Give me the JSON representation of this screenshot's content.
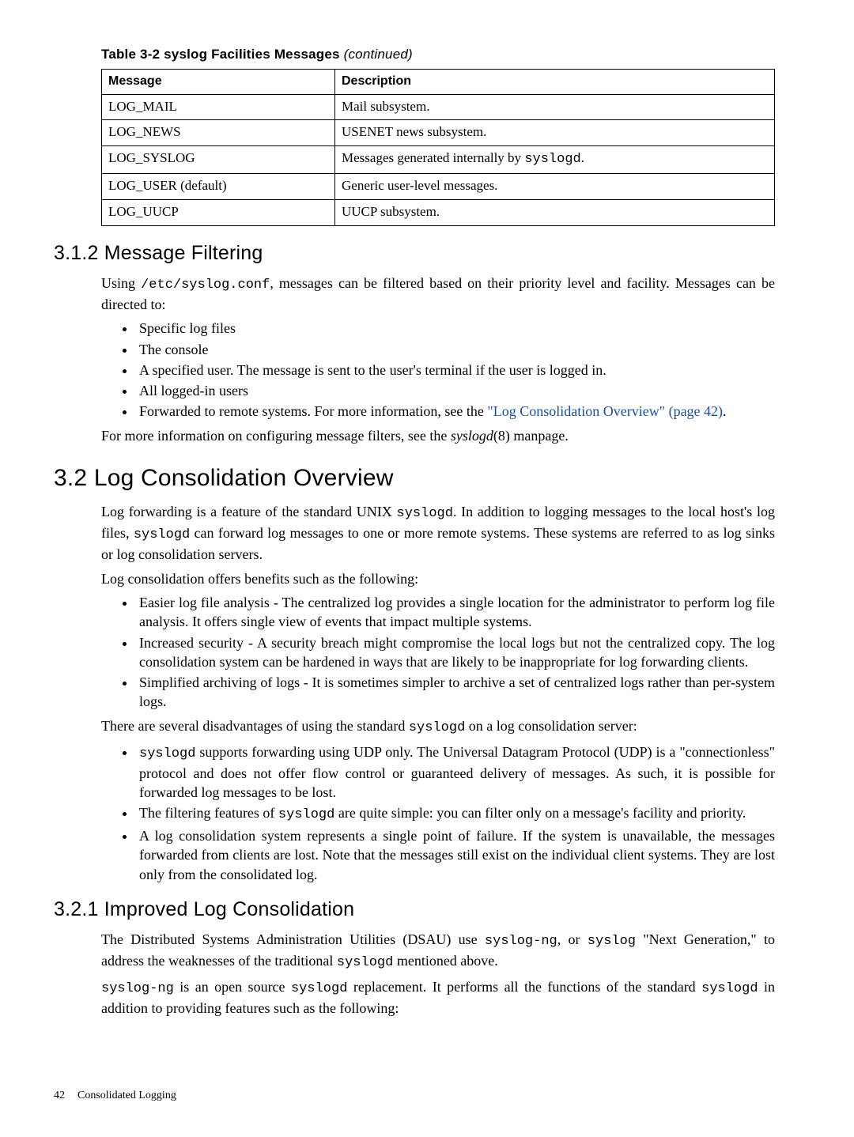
{
  "table": {
    "caption_prefix": "Table 3-2 syslog Facilities Messages ",
    "caption_suffix": "(continued)",
    "headers": [
      "Message",
      "Description"
    ],
    "rows": [
      {
        "msg": "LOG_MAIL",
        "desc_pre": "Mail subsystem.",
        "code": "",
        "desc_post": ""
      },
      {
        "msg": "LOG_NEWS",
        "desc_pre": "USENET news subsystem.",
        "code": "",
        "desc_post": ""
      },
      {
        "msg": "LOG_SYSLOG",
        "desc_pre": "Messages generated internally by ",
        "code": "syslogd",
        "desc_post": "."
      },
      {
        "msg": "LOG_USER (default)",
        "desc_pre": "Generic user-level messages.",
        "code": "",
        "desc_post": ""
      },
      {
        "msg": "LOG_UUCP",
        "desc_pre": "UUCP subsystem.",
        "code": "",
        "desc_post": ""
      }
    ]
  },
  "s312": {
    "heading": "3.1.2 Message Filtering",
    "p1_a": "Using ",
    "p1_code": "/etc/syslog.conf",
    "p1_b": ", messages can be filtered based on their priority level and facility. Messages can be directed to:",
    "bullets": {
      "b1": "Specific log files",
      "b2": "The console",
      "b3": "A specified user. The message is sent to the user's terminal if the user is logged in.",
      "b4": "All logged-in users",
      "b5_a": "Forwarded to remote systems. For more information, see the ",
      "b5_link": "\"Log Consolidation Overview\" (page 42)",
      "b5_b": "."
    },
    "p2_a": "For more information on configuring message filters, see the ",
    "p2_em": "syslogd",
    "p2_b": "(8) manpage."
  },
  "s32": {
    "heading": "3.2 Log Consolidation Overview",
    "p1_a": "Log forwarding is a feature of the standard UNIX ",
    "p1_code1": "syslogd",
    "p1_b": ". In addition to logging messages to the local host's log files, ",
    "p1_code2": "syslogd",
    "p1_c": " can forward log messages to one or more remote systems. These systems are referred to as log sinks or log consolidation servers.",
    "p2": "Log consolidation offers benefits such as the following:",
    "benefits": {
      "b1": "Easier log file analysis - The centralized log provides a single location for the administrator to perform log file analysis. It offers single view of events that impact multiple systems.",
      "b2": "Increased security - A security breach might compromise the local logs but not the centralized copy. The log consolidation system can be hardened in ways that are likely to be inappropriate for log forwarding clients.",
      "b3": "Simplified archiving of logs - It is sometimes simpler to archive a set of centralized logs rather than per-system logs."
    },
    "p3_a": "There are several disadvantages of using the standard ",
    "p3_code": "syslogd",
    "p3_b": " on a log consolidation server:",
    "disadv": {
      "d1_code": "syslogd",
      "d1_b": " supports forwarding using UDP only. The Universal Datagram Protocol (UDP) is a \"connectionless\" protocol and does not offer flow control or guaranteed delivery of messages. As such, it is possible for forwarded log messages to be lost.",
      "d2_a": "The filtering features of ",
      "d2_code": "syslogd",
      "d2_b": " are quite simple: you can filter only on a message's facility and priority.",
      "d3": "A log consolidation system represents a single point of failure. If the system is unavailable, the messages forwarded from clients are lost. Note that the messages still exist on the individual client systems. They are lost only from the consolidated log."
    }
  },
  "s321": {
    "heading": "3.2.1 Improved Log Consolidation",
    "p1_a": "The Distributed Systems Administration Utilities (DSAU) use ",
    "p1_code1": "syslog-ng",
    "p1_b": ", or ",
    "p1_code2": "syslog",
    "p1_c": " \"Next Generation,\" to address the weaknesses of the traditional ",
    "p1_code3": "syslogd",
    "p1_d": " mentioned above.",
    "p2_code1": "syslog-ng",
    "p2_a": " is an open source ",
    "p2_code2": "syslogd",
    "p2_b": " replacement. It performs all the functions of the standard ",
    "p2_code3": "syslogd",
    "p2_c": " in addition to providing features such as the following:"
  },
  "footer": {
    "page": "42",
    "title": "Consolidated Logging"
  }
}
